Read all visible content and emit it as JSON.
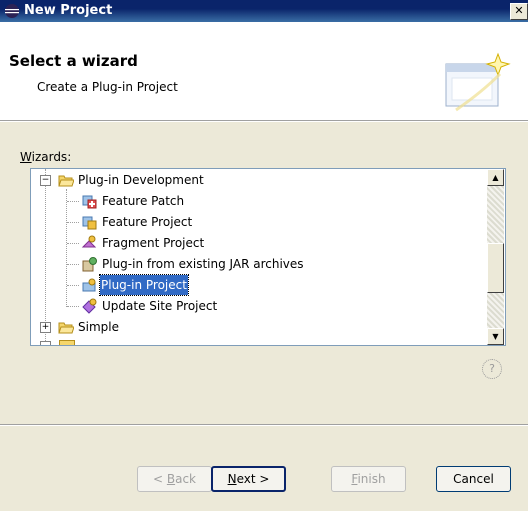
{
  "window": {
    "title": "New Project",
    "close_glyph": "✕"
  },
  "banner": {
    "heading": "Select a wizard",
    "description": "Create a Plug-in Project",
    "graphic_icon": "wizard-banner-icon"
  },
  "wizards": {
    "label_prefix": "W",
    "label_rest": "izards:",
    "tree": [
      {
        "label": "Plug-in Development",
        "icon": "folder-open-icon",
        "expander": "−",
        "level": 0
      },
      {
        "label": "Feature Patch",
        "icon": "feature-patch-icon",
        "level": 1
      },
      {
        "label": "Feature Project",
        "icon": "feature-project-icon",
        "level": 1
      },
      {
        "label": "Fragment Project",
        "icon": "fragment-project-icon",
        "level": 1
      },
      {
        "label": "Plug-in from existing JAR archives",
        "icon": "jar-plugin-icon",
        "level": 1
      },
      {
        "label": "Plug-in Project",
        "icon": "plugin-project-icon",
        "level": 1,
        "selected": true
      },
      {
        "label": "Update Site Project",
        "icon": "update-site-icon",
        "level": 1
      },
      {
        "label": "Simple",
        "icon": "folder-icon",
        "expander": "+",
        "level": 0
      }
    ]
  },
  "buttons": {
    "back_u": "B",
    "back_pre": "< ",
    "back_rest": "ack",
    "next_u": "N",
    "next_rest": "ext >",
    "finish_u": "F",
    "finish_rest": "inish",
    "cancel": "Cancel"
  },
  "help_glyph": "?",
  "colors": {
    "selection": "#316ac5",
    "titlebar": "#0a246a",
    "dialog_bg": "#ece9d8"
  }
}
